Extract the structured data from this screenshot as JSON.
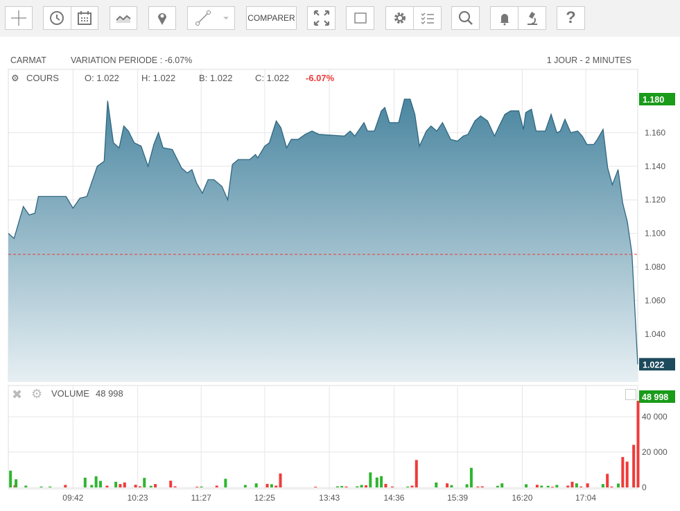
{
  "toolbar": {
    "buttons": [
      {
        "name": "crosshair",
        "icon": "crosshair-icon"
      },
      {
        "name": "history",
        "icon": "clock-icon"
      },
      {
        "name": "calendar",
        "icon": "calendar-icon"
      },
      {
        "name": "chart-type",
        "icon": "area-chart-icon"
      },
      {
        "name": "marker",
        "icon": "map-pin-icon"
      },
      {
        "name": "drawing-line",
        "icon": "line-tool-icon"
      },
      {
        "name": "drawing-dropdown",
        "icon": "caret-down-icon"
      },
      {
        "name": "fullscreen",
        "icon": "expand-icon"
      },
      {
        "name": "frame",
        "icon": "frame-icon"
      },
      {
        "name": "settings",
        "icon": "gear-icon"
      },
      {
        "name": "indicators",
        "icon": "checklist-icon"
      },
      {
        "name": "search",
        "icon": "search-icon"
      },
      {
        "name": "alert",
        "icon": "bell-icon"
      },
      {
        "name": "analysis",
        "icon": "microscope-icon"
      },
      {
        "name": "help",
        "icon": "question-icon"
      }
    ],
    "compare_label": "COMPARER"
  },
  "header": {
    "symbol": "CARMAT",
    "variation": "VARIATION PERIODE : -6.07%",
    "period": "1 JOUR - 2 MINUTES"
  },
  "cours": {
    "label": "COURS",
    "open": "O: 1.022",
    "high": "H: 1.022",
    "low": "B: 1.022",
    "close": "C: 1.022",
    "change": "-6.07%"
  },
  "volume": {
    "label": "VOLUME",
    "value": "48 998"
  },
  "colors": {
    "line": "#3f7690",
    "up": "#2fb52f",
    "down": "#f03a3a",
    "last_badge": "#1d4a5c",
    "high_badge": "#1a9b1a",
    "prev_close": "#e53935"
  },
  "chart_data": [
    {
      "type": "area",
      "title": "COURS",
      "ylim": [
        1.02,
        1.19
      ],
      "yticks": [
        "1.040",
        "1.060",
        "1.080",
        "1.100",
        "1.120",
        "1.140",
        "1.160"
      ],
      "prev_close": 1.0875,
      "high_label": "1.180",
      "last_label": "1.022",
      "x_max": 545,
      "xticks": [
        {
          "t": 56,
          "label": "09:42"
        },
        {
          "t": 112,
          "label": "10:23"
        },
        {
          "t": 167,
          "label": "11:27"
        },
        {
          "t": 222,
          "label": "12:25"
        },
        {
          "t": 278,
          "label": "13:43"
        },
        {
          "t": 334,
          "label": "14:36"
        },
        {
          "t": 389,
          "label": "15:39"
        },
        {
          "t": 445,
          "label": "16:20"
        },
        {
          "t": 500,
          "label": "17:04"
        }
      ],
      "points": [
        [
          0,
          1.1
        ],
        [
          5,
          1.097
        ],
        [
          13,
          1.116
        ],
        [
          18,
          1.111
        ],
        [
          23,
          1.112
        ],
        [
          26,
          1.122
        ],
        [
          50,
          1.122
        ],
        [
          56,
          1.115
        ],
        [
          62,
          1.121
        ],
        [
          68,
          1.122
        ],
        [
          77,
          1.14
        ],
        [
          83,
          1.143
        ],
        [
          86,
          1.179
        ],
        [
          91,
          1.154
        ],
        [
          96,
          1.151
        ],
        [
          100,
          1.164
        ],
        [
          104,
          1.161
        ],
        [
          109,
          1.154
        ],
        [
          115,
          1.152
        ],
        [
          121,
          1.14
        ],
        [
          126,
          1.153
        ],
        [
          130,
          1.16
        ],
        [
          134,
          1.151
        ],
        [
          142,
          1.15
        ],
        [
          150,
          1.139
        ],
        [
          155,
          1.136
        ],
        [
          159,
          1.138
        ],
        [
          163,
          1.13
        ],
        [
          168,
          1.124
        ],
        [
          173,
          1.132
        ],
        [
          178,
          1.132
        ],
        [
          185,
          1.128
        ],
        [
          190,
          1.12
        ],
        [
          194,
          1.141
        ],
        [
          199,
          1.144
        ],
        [
          209,
          1.144
        ],
        [
          214,
          1.147
        ],
        [
          216,
          1.145
        ],
        [
          222,
          1.152
        ],
        [
          226,
          1.154
        ],
        [
          232,
          1.167
        ],
        [
          236,
          1.163
        ],
        [
          241,
          1.151
        ],
        [
          245,
          1.156
        ],
        [
          251,
          1.156
        ],
        [
          257,
          1.159
        ],
        [
          263,
          1.161
        ],
        [
          269,
          1.159
        ],
        [
          291,
          1.158
        ],
        [
          296,
          1.161
        ],
        [
          300,
          1.158
        ],
        [
          308,
          1.166
        ],
        [
          311,
          1.161
        ],
        [
          317,
          1.161
        ],
        [
          323,
          1.173
        ],
        [
          326,
          1.175
        ],
        [
          330,
          1.166
        ],
        [
          338,
          1.166
        ],
        [
          343,
          1.18
        ],
        [
          348,
          1.18
        ],
        [
          352,
          1.171
        ],
        [
          356,
          1.152
        ],
        [
          362,
          1.161
        ],
        [
          366,
          1.164
        ],
        [
          371,
          1.161
        ],
        [
          376,
          1.166
        ],
        [
          383,
          1.156
        ],
        [
          389,
          1.155
        ],
        [
          394,
          1.158
        ],
        [
          398,
          1.159
        ],
        [
          404,
          1.167
        ],
        [
          409,
          1.17
        ],
        [
          415,
          1.167
        ],
        [
          421,
          1.158
        ],
        [
          425,
          1.164
        ],
        [
          430,
          1.171
        ],
        [
          435,
          1.173
        ],
        [
          442,
          1.173
        ],
        [
          446,
          1.162
        ],
        [
          448,
          1.172
        ],
        [
          453,
          1.174
        ],
        [
          457,
          1.161
        ],
        [
          465,
          1.161
        ],
        [
          470,
          1.171
        ],
        [
          475,
          1.16
        ],
        [
          478,
          1.161
        ],
        [
          482,
          1.168
        ],
        [
          487,
          1.16
        ],
        [
          493,
          1.161
        ],
        [
          497,
          1.158
        ],
        [
          501,
          1.153
        ],
        [
          507,
          1.153
        ],
        [
          510,
          1.156
        ],
        [
          515,
          1.162
        ],
        [
          519,
          1.139
        ],
        [
          523,
          1.129
        ],
        [
          528,
          1.138
        ],
        [
          532,
          1.118
        ],
        [
          536,
          1.107
        ],
        [
          540,
          1.088
        ],
        [
          545,
          1.022
        ]
      ]
    },
    {
      "type": "bar",
      "title": "VOLUME",
      "ylim": [
        0,
        52000
      ],
      "yticks": [
        "0",
        "20 000",
        "40 000"
      ],
      "ytick_values": [
        0,
        20000,
        40000
      ],
      "last_label": "48 998",
      "bars": [
        [
          0,
          9500,
          "up"
        ],
        [
          -1,
          0,
          ""
        ],
        [
          -1,
          0,
          ""
        ]
      ]
    }
  ],
  "volume_bars": [
    [
      1,
      9500,
      "up"
    ],
    [
      3,
      1300,
      "down"
    ],
    [
      3.2,
      0,
      ""
    ],
    [
      3.5,
      4600,
      "up"
    ],
    [
      8,
      1000,
      "up"
    ],
    [
      15,
      500,
      "up"
    ],
    [
      19,
      500,
      "up"
    ],
    [
      26,
      1400,
      "down"
    ],
    [
      35,
      5500,
      "up"
    ],
    [
      38,
      1400,
      "up"
    ],
    [
      40,
      6300,
      "up"
    ],
    [
      42,
      3700,
      "up"
    ],
    [
      45,
      1000,
      "down"
    ],
    [
      49,
      3200,
      "up"
    ],
    [
      51,
      1900,
      "down"
    ],
    [
      53,
      2800,
      "down"
    ],
    [
      58,
      1500,
      "down"
    ],
    [
      60,
      600,
      "down"
    ],
    [
      62,
      5400,
      "up"
    ],
    [
      65,
      900,
      "up"
    ],
    [
      67,
      1900,
      "down"
    ],
    [
      74,
      3800,
      "down"
    ],
    [
      76,
      600,
      "down"
    ],
    [
      86,
      400,
      "down"
    ],
    [
      88,
      500,
      "up"
    ],
    [
      95,
      1000,
      "down"
    ],
    [
      99,
      4900,
      "up"
    ],
    [
      108,
      1400,
      "up"
    ],
    [
      113,
      2300,
      "up"
    ],
    [
      118,
      2000,
      "down"
    ],
    [
      120,
      1800,
      "up"
    ],
    [
      122,
      1000,
      "down"
    ],
    [
      124,
      7900,
      "down"
    ],
    [
      140,
      400,
      "down"
    ],
    [
      150,
      600,
      "up"
    ],
    [
      152,
      800,
      "up"
    ],
    [
      154,
      500,
      "down"
    ],
    [
      159,
      600,
      "up"
    ],
    [
      161,
      1400,
      "up"
    ],
    [
      163,
      1200,
      "down"
    ],
    [
      165,
      8500,
      "up"
    ],
    [
      168,
      5600,
      "up"
    ],
    [
      170,
      6400,
      "up"
    ],
    [
      172,
      2000,
      "down"
    ],
    [
      175,
      500,
      "down"
    ],
    [
      182,
      500,
      "up"
    ],
    [
      184,
      1000,
      "down"
    ],
    [
      186,
      15500,
      "down"
    ],
    [
      195,
      2800,
      "up"
    ],
    [
      200,
      2300,
      "down"
    ],
    [
      202,
      1300,
      "up"
    ],
    [
      209,
      1800,
      "up"
    ],
    [
      211,
      11100,
      "up"
    ],
    [
      214,
      500,
      "down"
    ],
    [
      216,
      600,
      "down"
    ],
    [
      223,
      900,
      "up"
    ],
    [
      225,
      2300,
      "up"
    ],
    [
      236,
      1800,
      "up"
    ],
    [
      241,
      1500,
      "down"
    ],
    [
      243,
      1000,
      "up"
    ],
    [
      246,
      900,
      "up"
    ],
    [
      248,
      400,
      "down"
    ],
    [
      250,
      1400,
      "up"
    ],
    [
      255,
      1000,
      "down"
    ],
    [
      257,
      3200,
      "down"
    ],
    [
      259,
      2300,
      "up"
    ],
    [
      261,
      500,
      "down"
    ],
    [
      264,
      2300,
      "down"
    ],
    [
      271,
      1900,
      "up"
    ],
    [
      273,
      7700,
      "down"
    ],
    [
      275,
      500,
      "down"
    ],
    [
      278,
      2200,
      "up"
    ],
    [
      280,
      17200,
      "down"
    ],
    [
      282,
      14600,
      "down"
    ],
    [
      285,
      24100,
      "down"
    ],
    [
      287,
      48998,
      "down"
    ]
  ]
}
